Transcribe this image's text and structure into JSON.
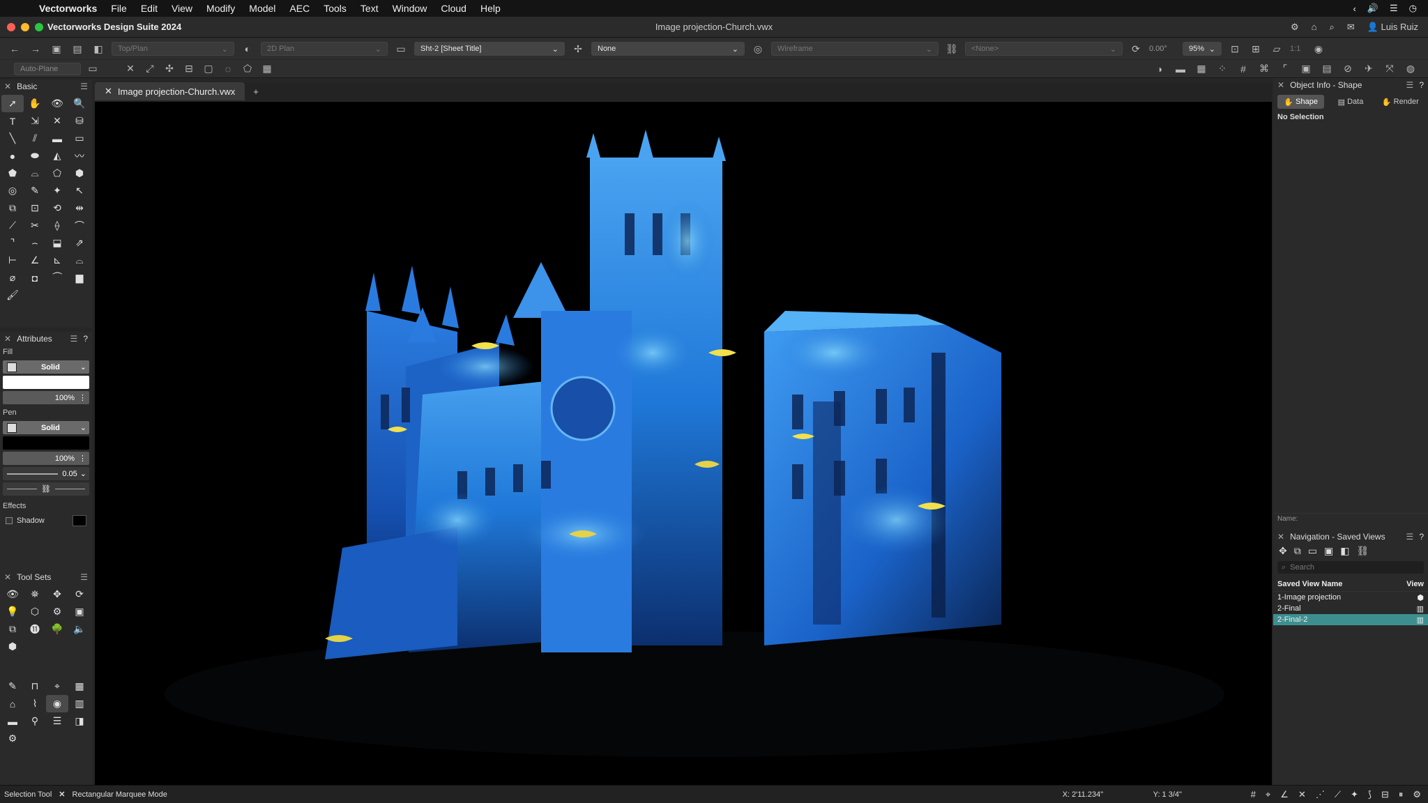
{
  "menubar": {
    "app": "Vectorworks",
    "items": [
      "File",
      "Edit",
      "View",
      "Modify",
      "Model",
      "AEC",
      "Tools",
      "Text",
      "Window",
      "Cloud",
      "Help"
    ]
  },
  "titlebar": {
    "app_title": "Vectorworks Design Suite 2024",
    "document": "Image projection-Church.vwx",
    "user": "Luis Ruiz"
  },
  "view_bar": {
    "view": "Top/Plan",
    "projection": "2D Plan",
    "sheet": "Sht-2 [Sheet Title]",
    "class": "None",
    "render": "Wireframe",
    "layer": "<None>",
    "rotation": "0.00°",
    "zoom": "95%",
    "scale": "1:1"
  },
  "mode_bar": {
    "plane": "Auto-Plane"
  },
  "doc_tab": {
    "label": "Image projection-Church.vwx",
    "add": "+"
  },
  "basic_palette": {
    "title": "Basic"
  },
  "attributes": {
    "title": "Attributes",
    "fill_label": "Fill",
    "fill_style": "Solid",
    "fill_opacity": "100%",
    "pen_label": "Pen",
    "pen_style": "Solid",
    "pen_opacity": "100%",
    "pen_thickness": "0.05",
    "effects_label": "Effects",
    "shadow_label": "Shadow"
  },
  "toolsets": {
    "title": "Tool Sets"
  },
  "object_info": {
    "title": "Object Info - Shape",
    "tabs": [
      "Shape",
      "Data",
      "Render"
    ],
    "status": "No Selection",
    "name_label": "Name:"
  },
  "navigation": {
    "title": "Navigation - Saved Views",
    "search_placeholder": "Search",
    "col_name": "Saved View Name",
    "col_view": "View",
    "rows": [
      "1-Image projection",
      "2-Final",
      "2-Final-2"
    ]
  },
  "status": {
    "tool": "Selection Tool",
    "mode": "Rectangular Marquee Mode",
    "x": "X: 2'11.234\"",
    "y": "Y: 1 3/4\""
  },
  "colors": {
    "accent": "#3d8f8f",
    "projection_blue": "#1a6fd8"
  }
}
